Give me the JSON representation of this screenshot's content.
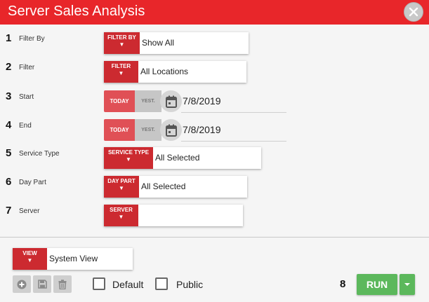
{
  "header": {
    "title": "Server Sales Analysis"
  },
  "rows": [
    {
      "num": "1",
      "label": "Filter By",
      "tag_lines": [
        "FILTER BY"
      ],
      "value": "Show All"
    },
    {
      "num": "2",
      "label": "Filter",
      "tag_lines": [
        "FILTER"
      ],
      "value": "All Locations"
    },
    {
      "num": "3",
      "label": "Start",
      "today": "TODAY",
      "yest": "YEST.",
      "value": "7/8/2019"
    },
    {
      "num": "4",
      "label": "End",
      "today": "TODAY",
      "yest": "YEST.",
      "value": "7/8/2019"
    },
    {
      "num": "5",
      "label": "Service Type",
      "tag_lines": [
        "SERVICE TYPE"
      ],
      "value": "All Selected"
    },
    {
      "num": "6",
      "label": "Day Part",
      "tag_lines": [
        "DAY PART"
      ],
      "value": "All Selected"
    },
    {
      "num": "7",
      "label": "Server",
      "tag_lines": [
        "SERVER"
      ],
      "value": ""
    }
  ],
  "view": {
    "tag": "VIEW",
    "value": "System View"
  },
  "options": {
    "default_label": "Default",
    "public_label": "Public"
  },
  "run": {
    "num": "8",
    "label": "RUN"
  },
  "icons": {
    "close": "close-icon",
    "calendar": "calendar-icon",
    "add": "add-icon",
    "save": "save-icon",
    "delete": "trash-icon"
  },
  "colors": {
    "header": "#e8262a",
    "tag": "#cc2a30",
    "run": "#5cb85c"
  }
}
